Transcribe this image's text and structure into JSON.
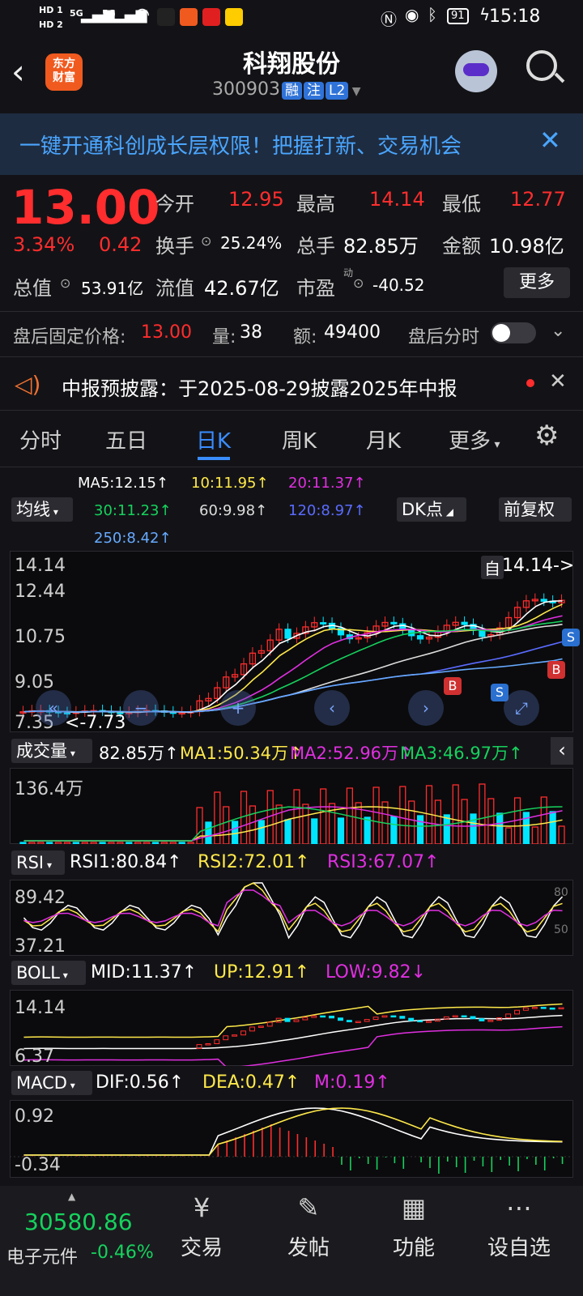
{
  "status": {
    "hd1": "HD 1",
    "hd2": "HD 2",
    "net1": "5G",
    "net2": "5G",
    "battery": "91",
    "time": "15:18"
  },
  "header": {
    "app_icon_line1": "东方",
    "app_icon_line2": "财富",
    "title": "科翔股份",
    "code": "300903",
    "tag_rong": "融",
    "tag_zhu": "注",
    "tag_l2": "L2"
  },
  "banner": {
    "text": "一键开通科创成长层权限！把握打新、交易机会"
  },
  "quote": {
    "price": "13.00",
    "pct": "3.34%",
    "chg": "0.42",
    "open_label": "今开",
    "open": "12.95",
    "high_label": "最高",
    "high": "14.14",
    "low_label": "最低",
    "low": "12.77",
    "turnover_label": "换手",
    "turnover": "25.24%",
    "volume_label": "总手",
    "volume": "82.85万",
    "amount_label": "金额",
    "amount": "10.98亿",
    "mktcap_label": "总值",
    "mktcap": "53.91亿",
    "float_label": "流值",
    "float": "42.67亿",
    "pe_label": "市盈",
    "pe_sup": "动",
    "pe": "-40.52",
    "more_btn": "更多"
  },
  "afterhours": {
    "label": "盘后固定价格:",
    "price": "13.00",
    "vol_label": "量:",
    "vol": "38",
    "amt_label": "额:",
    "amt": "49400",
    "timeline_label": "盘后分时"
  },
  "notice": {
    "text": "中报预披露：于2025-08-29披露2025年中报"
  },
  "tabs": [
    "分时",
    "五日",
    "日K",
    "周K",
    "月K",
    "更多"
  ],
  "ma_legend": {
    "ma5": "MA5:12.15↑",
    "ma10": "10:11.95↑",
    "ma20": "20:11.37↑",
    "ma30": "30:11.23↑",
    "ma60": "60:9.98↑",
    "ma120": "120:8.97↑",
    "ma250": "250:8.42↑",
    "btn_ma": "均线",
    "btn_dk": "DK点",
    "btn_fq": "前复权"
  },
  "kline": {
    "y_labels": [
      "14.14",
      "12.44",
      "10.75",
      "9.05",
      "7.35"
    ],
    "max_tag": "14.14->",
    "min_tag": "<-7.73",
    "marker_b": "B",
    "marker_s": "S",
    "self_tag": "自"
  },
  "volume": {
    "btn": "成交量",
    "v": "82.85万↑",
    "ma1": "MA1:50.34万↑",
    "ma2": "MA2:52.96万↑",
    "ma3": "MA3:46.97万↑",
    "y_label": "136.4万"
  },
  "rsi": {
    "btn": "RSI",
    "rsi1": "RSI1:80.84↑",
    "rsi2": "RSI2:72.01↑",
    "rsi3": "RSI3:67.07↑",
    "y_top": "89.42",
    "y_bot": "37.21",
    "ref_80": "80",
    "ref_50": "50"
  },
  "boll": {
    "btn": "BOLL",
    "mid": "MID:11.37↑",
    "up": "UP:12.91↑",
    "low": "LOW:9.82↓",
    "y_top": "14.14",
    "y_bot": "6.37"
  },
  "macd": {
    "btn": "MACD",
    "dif": "DIF:0.56↑",
    "dea": "DEA:0.47↑",
    "m": "M:0.19↑",
    "y_top": "0.92",
    "y_bot": "-0.34"
  },
  "bottom": {
    "index_value": "30580.86",
    "index_name": "电子元件",
    "index_pct": "-0.46%",
    "nav_trade": "交易",
    "nav_post": "发帖",
    "nav_func": "功能",
    "nav_watch": "设自选"
  },
  "colors": {
    "up": "#ff2d2d",
    "down": "#16d25d",
    "cyan": "#00e5ff",
    "yellow": "#ffe94a",
    "magenta": "#e02fe0",
    "accent": "#3a8dff"
  }
}
